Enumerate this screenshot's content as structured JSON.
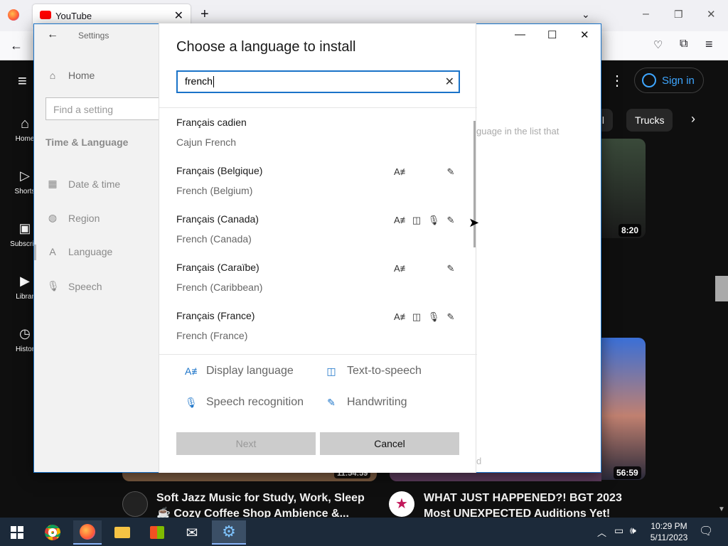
{
  "browser": {
    "tab_title": "YouTube",
    "new_tab": "+",
    "tab_close": "✕",
    "win_min": "–",
    "win_restore": "❐",
    "win_close": "✕"
  },
  "youtube": {
    "sign_in": "Sign in",
    "chips": [
      "all",
      "Trucks"
    ],
    "sidebar": [
      {
        "label": "Home",
        "icon": "home-icon"
      },
      {
        "label": "Shorts",
        "icon": "shorts-icon"
      },
      {
        "label": "Subscript",
        "icon": "subscriptions-icon"
      },
      {
        "label": "Librar",
        "icon": "library-icon"
      },
      {
        "label": "Histor",
        "icon": "history-icon"
      }
    ],
    "durations": [
      "8:20",
      "11:54:59",
      "56:59"
    ],
    "videos": [
      {
        "title_line1": "Soft Jazz Music for Study, Work, Sleep",
        "title_line2": "☕ Cozy Coffee Shop Ambience &..."
      },
      {
        "title_line1": "WHAT JUST HAPPENED?! BGT 2023",
        "title_line2": "Most UNEXPECTED Auditions Yet!"
      }
    ],
    "hint_text": "guage in the list that",
    "hint_tail": "d"
  },
  "settings": {
    "title": "Settings",
    "home": "Home",
    "find_placeholder": "Find a setting",
    "section": "Time & Language",
    "nav": [
      {
        "label": "Date & time",
        "icon": "calendar-icon"
      },
      {
        "label": "Region",
        "icon": "globe-icon"
      },
      {
        "label": "Language",
        "icon": "language-icon"
      },
      {
        "label": "Speech",
        "icon": "microphone-icon"
      }
    ]
  },
  "dialog": {
    "title": "Choose a language to install",
    "search_value": "french",
    "languages": [
      {
        "native": "Français cadien",
        "english": "Cajun French",
        "features": []
      },
      {
        "native": "Français (Belgique)",
        "english": "French (Belgium)",
        "features": [
          "display",
          "handwriting"
        ]
      },
      {
        "native": "Français (Canada)",
        "english": "French (Canada)",
        "features": [
          "display",
          "tts",
          "speech",
          "handwriting"
        ]
      },
      {
        "native": "Français (Caraïbe)",
        "english": "French (Caribbean)",
        "features": [
          "display",
          "handwriting"
        ]
      },
      {
        "native": "Français (France)",
        "english": "French (France)",
        "features": [
          "display",
          "tts",
          "speech",
          "handwriting"
        ]
      }
    ],
    "legend": {
      "display": "Display language",
      "tts": "Text-to-speech",
      "speech": "Speech recognition",
      "handwriting": "Handwriting"
    },
    "next": "Next",
    "cancel": "Cancel"
  },
  "taskbar": {
    "time": "10:29 PM",
    "date": "5/11/2023"
  },
  "colors": {
    "accent": "#1a73c8",
    "taskbar": "#1c2a3a",
    "youtube_red": "#ff0000"
  }
}
